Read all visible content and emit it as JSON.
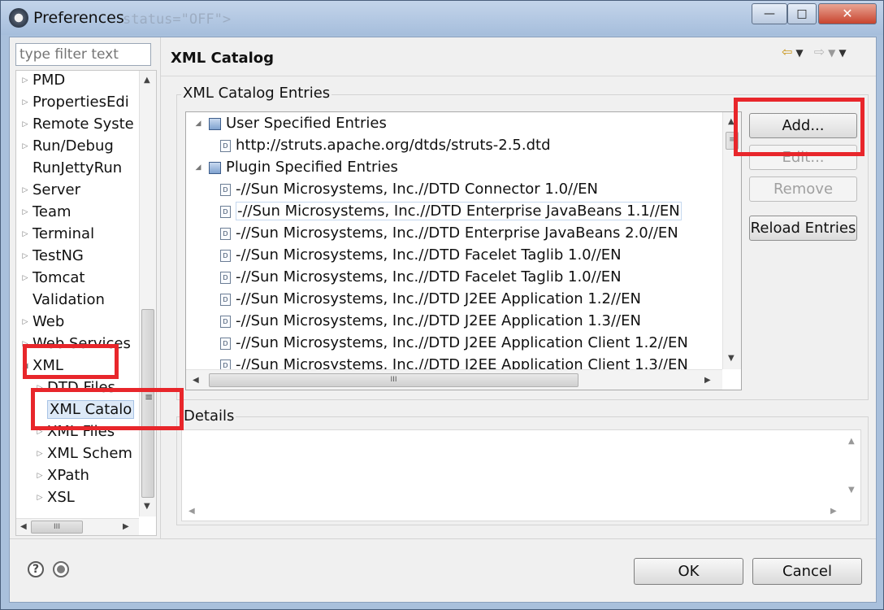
{
  "window": {
    "title": "Preferences",
    "ghost_text": "status=\"OFF\">",
    "minimize_label": "—",
    "maximize_label": "□",
    "close_label": "✕"
  },
  "filter": {
    "placeholder": "type filter text"
  },
  "sidebar": {
    "items": [
      {
        "label": "PMD",
        "twisty": "▷"
      },
      {
        "label": "PropertiesEdi",
        "twisty": "▷"
      },
      {
        "label": "Remote Syste",
        "twisty": "▷"
      },
      {
        "label": "Run/Debug",
        "twisty": "▷"
      },
      {
        "label": "RunJettyRun",
        "twisty": ""
      },
      {
        "label": "Server",
        "twisty": "▷"
      },
      {
        "label": "Team",
        "twisty": "▷"
      },
      {
        "label": "Terminal",
        "twisty": "▷"
      },
      {
        "label": "TestNG",
        "twisty": "▷"
      },
      {
        "label": "Tomcat",
        "twisty": "▷"
      },
      {
        "label": "Validation",
        "twisty": ""
      },
      {
        "label": "Web",
        "twisty": "▷"
      },
      {
        "label": "Web Services",
        "twisty": "▷"
      },
      {
        "label": "XML",
        "twisty": "◢"
      },
      {
        "label": "DTD Files",
        "twisty": "▷"
      },
      {
        "label": "XML Catalo",
        "twisty": ""
      },
      {
        "label": "XML Files",
        "twisty": "▷"
      },
      {
        "label": "XML Schem",
        "twisty": "▷"
      },
      {
        "label": "XPath",
        "twisty": "▷"
      },
      {
        "label": "XSL",
        "twisty": "▷"
      }
    ],
    "scroll_up": "▲",
    "scroll_down": "▼",
    "scroll_left": "◀",
    "scroll_right": "▶",
    "thumb_grip": "III"
  },
  "page": {
    "title": "XML Catalog",
    "nav_back": "⇦",
    "nav_back_menu": "▼",
    "nav_forward": "⇨",
    "nav_forward_menu": "▼",
    "view_menu": "▼"
  },
  "catalog": {
    "group_label": "XML Catalog Entries",
    "user_group": "User Specified Entries",
    "user_entries": [
      "http://struts.apache.org/dtds/struts-2.5.dtd"
    ],
    "plugin_group": "Plugin Specified Entries",
    "plugin_entries": [
      "-//Sun Microsystems, Inc.//DTD Connector 1.0//EN",
      "-//Sun Microsystems, Inc.//DTD Enterprise JavaBeans 1.1//EN",
      "-//Sun Microsystems, Inc.//DTD Enterprise JavaBeans 2.0//EN",
      "-//Sun Microsystems, Inc.//DTD Facelet Taglib 1.0//EN",
      "-//Sun Microsystems, Inc.//DTD Facelet Taglib 1.0//EN",
      "-//Sun Microsystems, Inc.//DTD J2EE Application 1.2//EN",
      "-//Sun Microsystems, Inc.//DTD J2EE Application 1.3//EN",
      "-//Sun Microsystems, Inc.//DTD J2EE Application Client 1.2//EN",
      "-//Sun Microsystems, Inc.//DTD J2EE Application Client 1.3//EN"
    ],
    "expanded_twisty": "◢",
    "file_icon_letter": "D",
    "scroll_up": "▲",
    "scroll_down": "▼",
    "scroll_left": "◀",
    "scroll_right": "▶",
    "thumb_grip_h": "III",
    "thumb_grip_v": "≡"
  },
  "buttons": {
    "add": "Add...",
    "edit": "Edit...",
    "remove": "Remove",
    "reload": "Reload Entries"
  },
  "details": {
    "label": "Details",
    "scroll_up": "▲",
    "scroll_down": "▼",
    "scroll_left": "◀",
    "scroll_right": "▶"
  },
  "footer": {
    "help_icon": "?",
    "ok": "OK",
    "cancel": "Cancel"
  },
  "annotation_color": "#e8262b"
}
